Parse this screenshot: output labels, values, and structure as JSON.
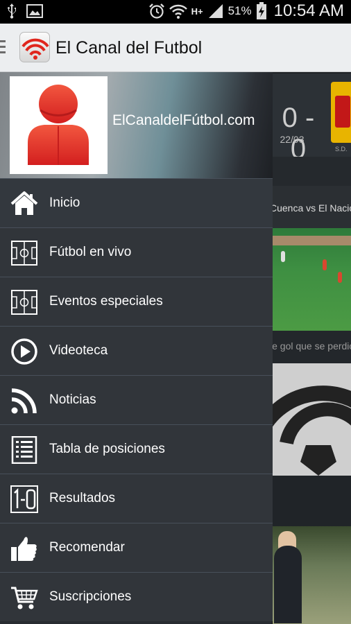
{
  "status_bar": {
    "battery": "51%",
    "network": "H+",
    "time": "10:54 AM",
    "icons": [
      "usb-icon",
      "image-icon",
      "alarm-icon",
      "wifi-icon",
      "network-type-icon",
      "signal-icon",
      "battery-charging-icon"
    ]
  },
  "action_bar": {
    "title": "El Canal del Futbol",
    "menu_icon": "hamburger-icon",
    "app_icon": "wifi-ball-app-icon"
  },
  "drawer": {
    "site_name": "ElCanaldelFútbol.com",
    "avatar": "user-avatar-icon",
    "items": [
      {
        "label": "Inicio",
        "icon": "home-icon"
      },
      {
        "label": "Fútbol en vivo",
        "icon": "soccer-field-icon"
      },
      {
        "label": "Eventos especiales",
        "icon": "soccer-field-icon"
      },
      {
        "label": "Videoteca",
        "icon": "play-icon"
      },
      {
        "label": "Noticias",
        "icon": "rss-icon"
      },
      {
        "label": "Tabla de posiciones",
        "icon": "list-icon"
      },
      {
        "label": "Resultados",
        "icon": "scoreboard-icon"
      },
      {
        "label": "Recomendar",
        "icon": "thumbs-up-icon"
      },
      {
        "label": "Suscripciones",
        "icon": "shopping-cart-icon"
      }
    ]
  },
  "background_content": {
    "score": "0 - 0",
    "score_date": "22/03",
    "team_label": "S.D.",
    "headline_1": "Cuenca vs El Nacional",
    "headline_2": "le gol que se perdió"
  },
  "colors": {
    "drawer_bg": "#31353a",
    "divider": "#48505a",
    "action_bar_bg": "#eceef0",
    "accent_red": "#e43a2b"
  }
}
